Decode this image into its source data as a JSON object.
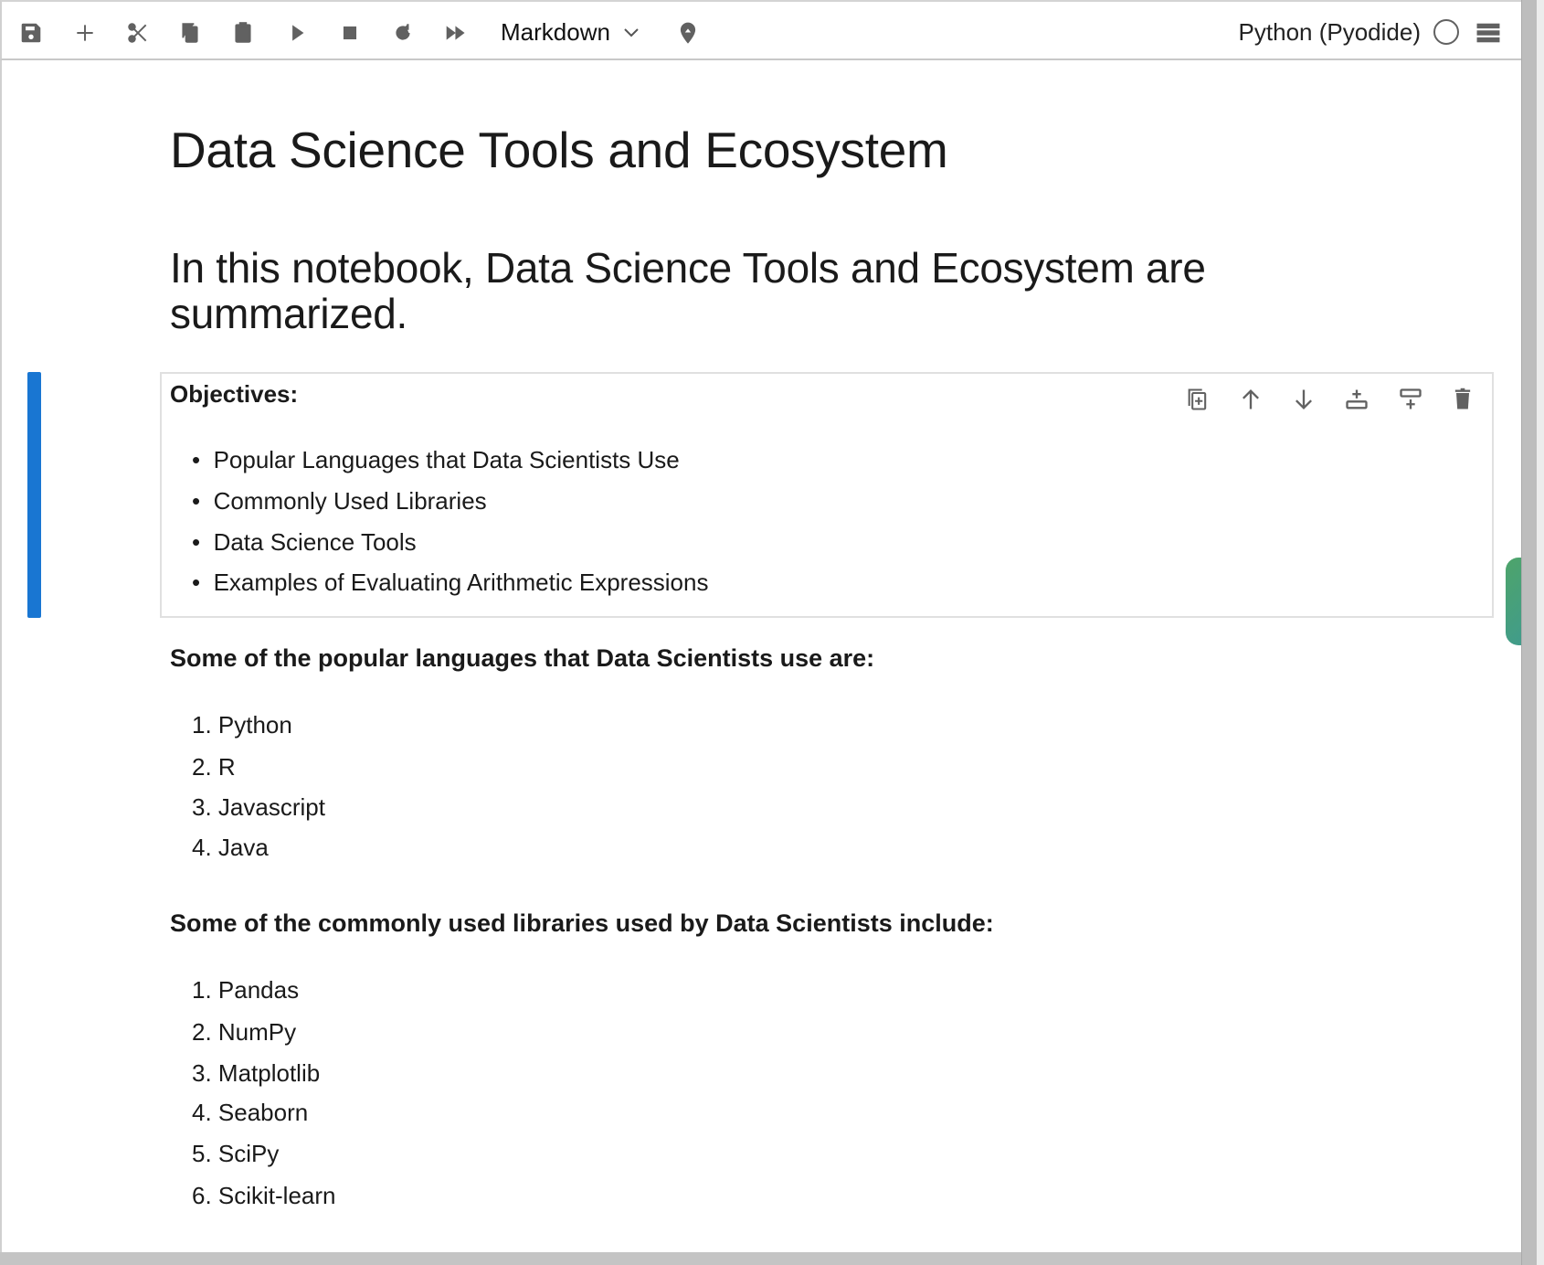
{
  "toolbar": {
    "icons": [
      "save-icon",
      "add-icon",
      "cut-icon",
      "copy-icon",
      "paste-icon",
      "run-icon",
      "stop-icon",
      "restart-icon",
      "run-all-icon"
    ],
    "cell_type": "Markdown",
    "kernel": "Python (Pyodide)",
    "kernel_status": "idle"
  },
  "notebook": {
    "title": "Data Science Tools and Ecosystem",
    "subtitle": "In this notebook, Data Science Tools and Ecosystem are summarized.",
    "objectives": {
      "heading": "Objectives:",
      "items": [
        "Popular Languages that Data Scientists Use",
        "Commonly Used Libraries",
        "Data Science Tools",
        "Examples of Evaluating Arithmetic Expressions"
      ]
    },
    "languages": {
      "heading": "Some of the popular languages that Data Scientists use are:",
      "items": [
        "1. Python",
        "2. R",
        "3. Javascript",
        "4. Java"
      ]
    },
    "libraries": {
      "heading": "Some of the commonly used libraries used by Data Scientists include:",
      "items": [
        "1. Pandas",
        "2. NumPy",
        "3. Matplotlib",
        "4. Seaborn",
        "5. SciPy",
        "6. Scikit-learn"
      ]
    }
  },
  "colors": {
    "active_cell": "#1976d2",
    "icon": "#616161"
  }
}
